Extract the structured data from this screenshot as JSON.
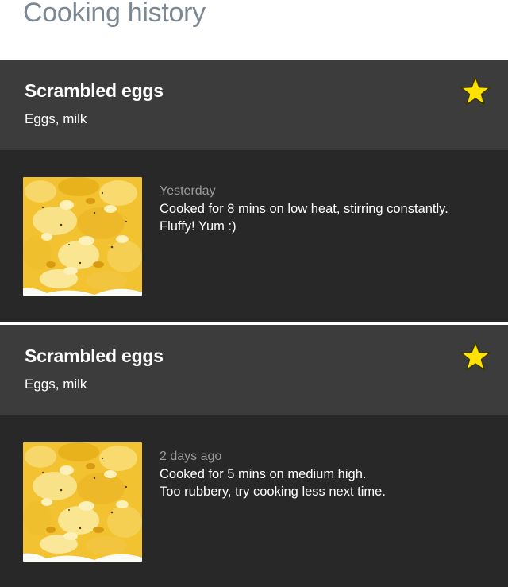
{
  "page": {
    "title": "Cooking history"
  },
  "entries": [
    {
      "title": "Scrambled eggs",
      "ingredients": "Eggs, milk",
      "favorite": true,
      "date": "Yesterday",
      "note_lines": [
        "Cooked for 8 mins on low heat, stirring constantly.",
        "Fluffy! Yum :)"
      ],
      "icon": "star-icon"
    },
    {
      "title": "Scrambled eggs",
      "ingredients": "Eggs, milk",
      "favorite": true,
      "date": "2 days ago",
      "note_lines": [
        "Cooked for 5 mins on medium high.",
        "Too rubbery, try cooking less next time."
      ],
      "icon": "star-icon"
    }
  ],
  "colors": {
    "header_bg": "#3c3c3c",
    "body_bg": "#282828",
    "star_fill": "#ffe200",
    "title_color": "#7c8794"
  }
}
